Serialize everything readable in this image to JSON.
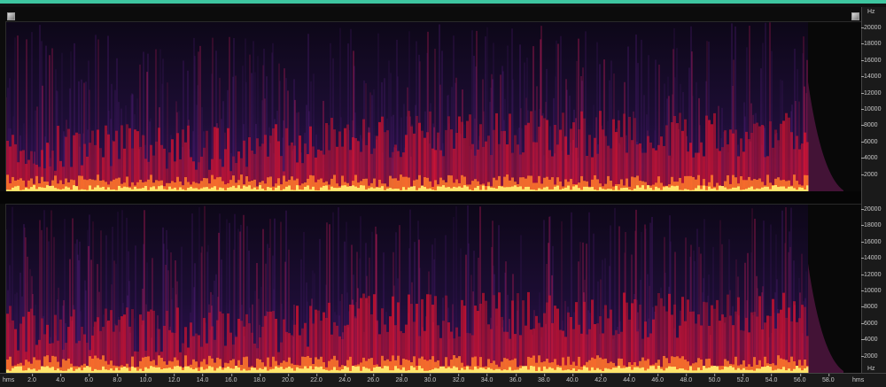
{
  "rulers": {
    "frequency_unit": "Hz",
    "time_unit_left": "hms",
    "time_unit_right": "hms",
    "ch1_freq_ticks": [
      "20000",
      "18000",
      "16000",
      "14000",
      "12000",
      "10000",
      "8000",
      "6000",
      "4000",
      "2000"
    ],
    "ch2_freq_ticks": [
      "20000",
      "18000",
      "16000",
      "14000",
      "12000",
      "10000",
      "8000",
      "6000",
      "4000",
      "2000"
    ],
    "time_ticks": [
      "2.0",
      "4.0",
      "6.0",
      "8.0",
      "10.0",
      "12.0",
      "14.0",
      "16.0",
      "18.0",
      "20.0",
      "22.0",
      "24.0",
      "26.0",
      "28.0",
      "30.0",
      "32.0",
      "34.0",
      "36.0",
      "38.0",
      "40.0",
      "42.0",
      "44.0",
      "46.0",
      "48.0",
      "50.0",
      "52.0",
      "54.0",
      "56.0",
      "58.0"
    ]
  },
  "colors": {
    "background": "#0c0c0c",
    "low_intensity": "#2a0f4a",
    "mid_intensity": "#e0142e",
    "high_intensity": "#ffe46a",
    "selection_bar": "#3ec7a0"
  },
  "spectrogram": {
    "channels": 2,
    "max_frequency_hz": 21000,
    "duration_s": 60,
    "audio_end_s": 55.5
  }
}
